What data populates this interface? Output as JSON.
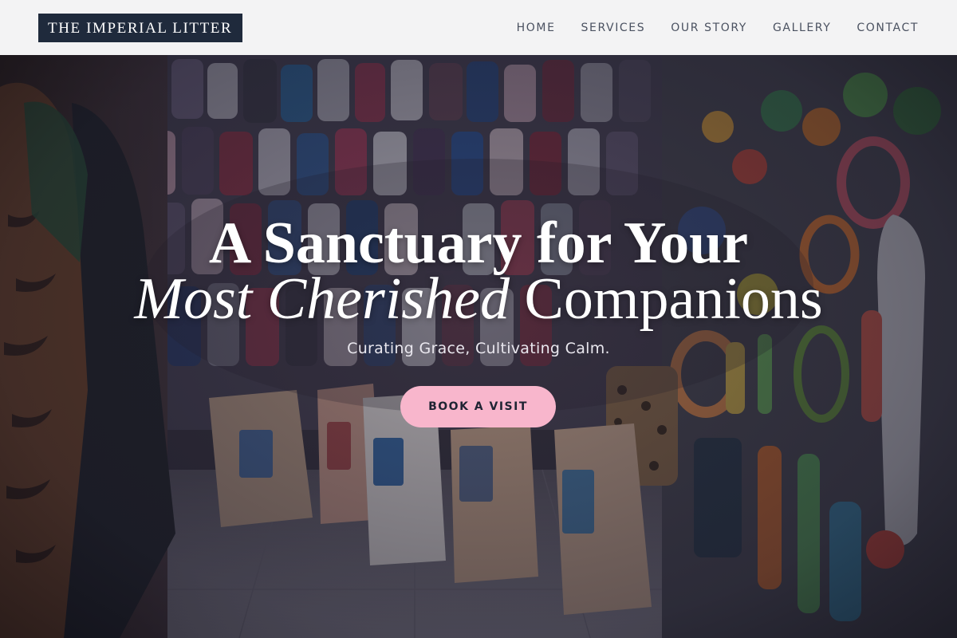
{
  "brand": {
    "logo_text": "THE IMPERIAL LITTER"
  },
  "nav": {
    "items": [
      {
        "label": "HOME"
      },
      {
        "label": "SERVICES"
      },
      {
        "label": "OUR STORY"
      },
      {
        "label": "GALLERY"
      },
      {
        "label": "CONTACT"
      }
    ]
  },
  "hero": {
    "headline_line1": "A Sanctuary for Your",
    "headline_italic": "Most Cherished",
    "headline_rest": " Companions",
    "tagline": "Curating Grace, Cultivating Calm.",
    "cta_label": "BOOK A VISIT",
    "image_alt": "Pet shop interior with cat food bags, pet clothing and toys on the walls"
  },
  "colors": {
    "header_bg": "#f3f3f4",
    "logo_bg": "#1f2a3c",
    "nav_text": "#4a5160",
    "cta_bg": "#f8b6cc",
    "cta_text": "#1f2433"
  }
}
